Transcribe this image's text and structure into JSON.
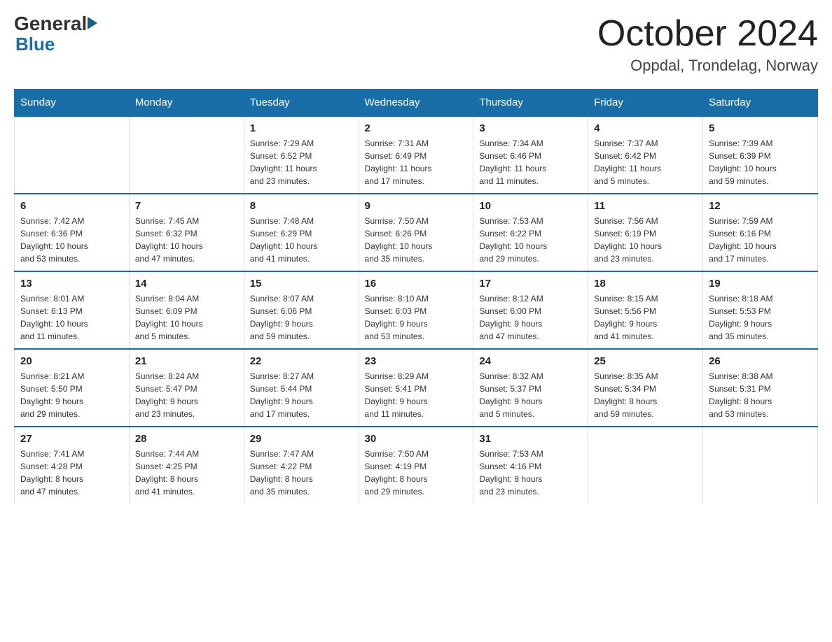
{
  "logo": {
    "general": "General",
    "blue": "Blue"
  },
  "title": "October 2024",
  "location": "Oppdal, Trondelag, Norway",
  "columns": [
    "Sunday",
    "Monday",
    "Tuesday",
    "Wednesday",
    "Thursday",
    "Friday",
    "Saturday"
  ],
  "weeks": [
    [
      {
        "day": "",
        "info": ""
      },
      {
        "day": "",
        "info": ""
      },
      {
        "day": "1",
        "info": "Sunrise: 7:29 AM\nSunset: 6:52 PM\nDaylight: 11 hours\nand 23 minutes."
      },
      {
        "day": "2",
        "info": "Sunrise: 7:31 AM\nSunset: 6:49 PM\nDaylight: 11 hours\nand 17 minutes."
      },
      {
        "day": "3",
        "info": "Sunrise: 7:34 AM\nSunset: 6:46 PM\nDaylight: 11 hours\nand 11 minutes."
      },
      {
        "day": "4",
        "info": "Sunrise: 7:37 AM\nSunset: 6:42 PM\nDaylight: 11 hours\nand 5 minutes."
      },
      {
        "day": "5",
        "info": "Sunrise: 7:39 AM\nSunset: 6:39 PM\nDaylight: 10 hours\nand 59 minutes."
      }
    ],
    [
      {
        "day": "6",
        "info": "Sunrise: 7:42 AM\nSunset: 6:36 PM\nDaylight: 10 hours\nand 53 minutes."
      },
      {
        "day": "7",
        "info": "Sunrise: 7:45 AM\nSunset: 6:32 PM\nDaylight: 10 hours\nand 47 minutes."
      },
      {
        "day": "8",
        "info": "Sunrise: 7:48 AM\nSunset: 6:29 PM\nDaylight: 10 hours\nand 41 minutes."
      },
      {
        "day": "9",
        "info": "Sunrise: 7:50 AM\nSunset: 6:26 PM\nDaylight: 10 hours\nand 35 minutes."
      },
      {
        "day": "10",
        "info": "Sunrise: 7:53 AM\nSunset: 6:22 PM\nDaylight: 10 hours\nand 29 minutes."
      },
      {
        "day": "11",
        "info": "Sunrise: 7:56 AM\nSunset: 6:19 PM\nDaylight: 10 hours\nand 23 minutes."
      },
      {
        "day": "12",
        "info": "Sunrise: 7:59 AM\nSunset: 6:16 PM\nDaylight: 10 hours\nand 17 minutes."
      }
    ],
    [
      {
        "day": "13",
        "info": "Sunrise: 8:01 AM\nSunset: 6:13 PM\nDaylight: 10 hours\nand 11 minutes."
      },
      {
        "day": "14",
        "info": "Sunrise: 8:04 AM\nSunset: 6:09 PM\nDaylight: 10 hours\nand 5 minutes."
      },
      {
        "day": "15",
        "info": "Sunrise: 8:07 AM\nSunset: 6:06 PM\nDaylight: 9 hours\nand 59 minutes."
      },
      {
        "day": "16",
        "info": "Sunrise: 8:10 AM\nSunset: 6:03 PM\nDaylight: 9 hours\nand 53 minutes."
      },
      {
        "day": "17",
        "info": "Sunrise: 8:12 AM\nSunset: 6:00 PM\nDaylight: 9 hours\nand 47 minutes."
      },
      {
        "day": "18",
        "info": "Sunrise: 8:15 AM\nSunset: 5:56 PM\nDaylight: 9 hours\nand 41 minutes."
      },
      {
        "day": "19",
        "info": "Sunrise: 8:18 AM\nSunset: 5:53 PM\nDaylight: 9 hours\nand 35 minutes."
      }
    ],
    [
      {
        "day": "20",
        "info": "Sunrise: 8:21 AM\nSunset: 5:50 PM\nDaylight: 9 hours\nand 29 minutes."
      },
      {
        "day": "21",
        "info": "Sunrise: 8:24 AM\nSunset: 5:47 PM\nDaylight: 9 hours\nand 23 minutes."
      },
      {
        "day": "22",
        "info": "Sunrise: 8:27 AM\nSunset: 5:44 PM\nDaylight: 9 hours\nand 17 minutes."
      },
      {
        "day": "23",
        "info": "Sunrise: 8:29 AM\nSunset: 5:41 PM\nDaylight: 9 hours\nand 11 minutes."
      },
      {
        "day": "24",
        "info": "Sunrise: 8:32 AM\nSunset: 5:37 PM\nDaylight: 9 hours\nand 5 minutes."
      },
      {
        "day": "25",
        "info": "Sunrise: 8:35 AM\nSunset: 5:34 PM\nDaylight: 8 hours\nand 59 minutes."
      },
      {
        "day": "26",
        "info": "Sunrise: 8:38 AM\nSunset: 5:31 PM\nDaylight: 8 hours\nand 53 minutes."
      }
    ],
    [
      {
        "day": "27",
        "info": "Sunrise: 7:41 AM\nSunset: 4:28 PM\nDaylight: 8 hours\nand 47 minutes."
      },
      {
        "day": "28",
        "info": "Sunrise: 7:44 AM\nSunset: 4:25 PM\nDaylight: 8 hours\nand 41 minutes."
      },
      {
        "day": "29",
        "info": "Sunrise: 7:47 AM\nSunset: 4:22 PM\nDaylight: 8 hours\nand 35 minutes."
      },
      {
        "day": "30",
        "info": "Sunrise: 7:50 AM\nSunset: 4:19 PM\nDaylight: 8 hours\nand 29 minutes."
      },
      {
        "day": "31",
        "info": "Sunrise: 7:53 AM\nSunset: 4:16 PM\nDaylight: 8 hours\nand 23 minutes."
      },
      {
        "day": "",
        "info": ""
      },
      {
        "day": "",
        "info": ""
      }
    ]
  ]
}
